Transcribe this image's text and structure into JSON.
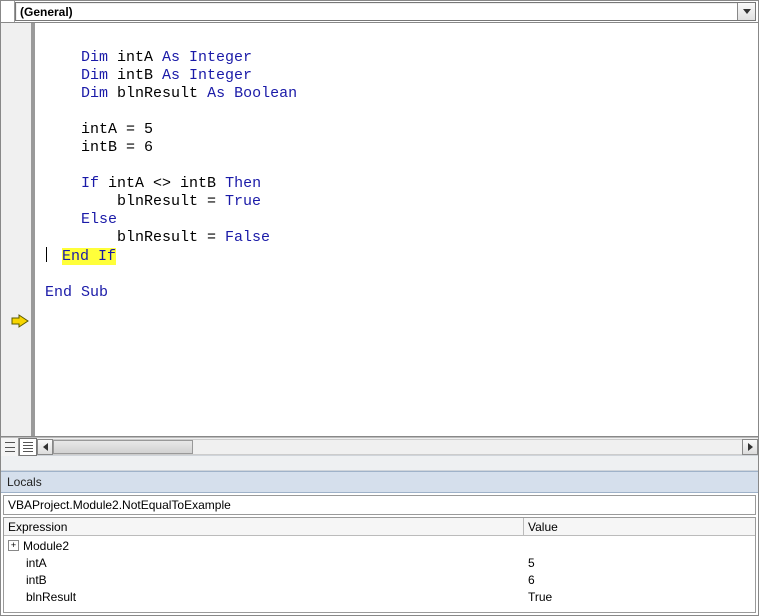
{
  "dropdown": {
    "selected": "(General)"
  },
  "code": {
    "l1": "",
    "l2": "    ",
    "l3a": "Dim",
    "l3b": " intA ",
    "l3c": "As Integer",
    "l4a": "Dim",
    "l4b": " intB ",
    "l4c": "As Integer",
    "l5a": "Dim",
    "l5b": " blnResult ",
    "l5c": "As Boolean",
    "l6": "",
    "l7": "    intA = 5",
    "l8": "    intB = 6",
    "l9": "",
    "l10a": "If",
    "l10b": " intA <> intB ",
    "l10c": "Then",
    "l11": "        blnResult = ",
    "l11b": "True",
    "l12": "Else",
    "l13": "        blnResult = ",
    "l13b": "False",
    "l14": "End If",
    "l15": "",
    "l16": "End Sub"
  },
  "locals": {
    "title": "Locals",
    "context": "VBAProject.Module2.NotEqualToExample",
    "headers": {
      "expr": "Expression",
      "value": "Value"
    },
    "rows": [
      {
        "name": "Module2",
        "value": "",
        "expandable": true
      },
      {
        "name": "intA",
        "value": "5"
      },
      {
        "name": "intB",
        "value": "6"
      },
      {
        "name": "blnResult",
        "value": "True"
      }
    ]
  }
}
